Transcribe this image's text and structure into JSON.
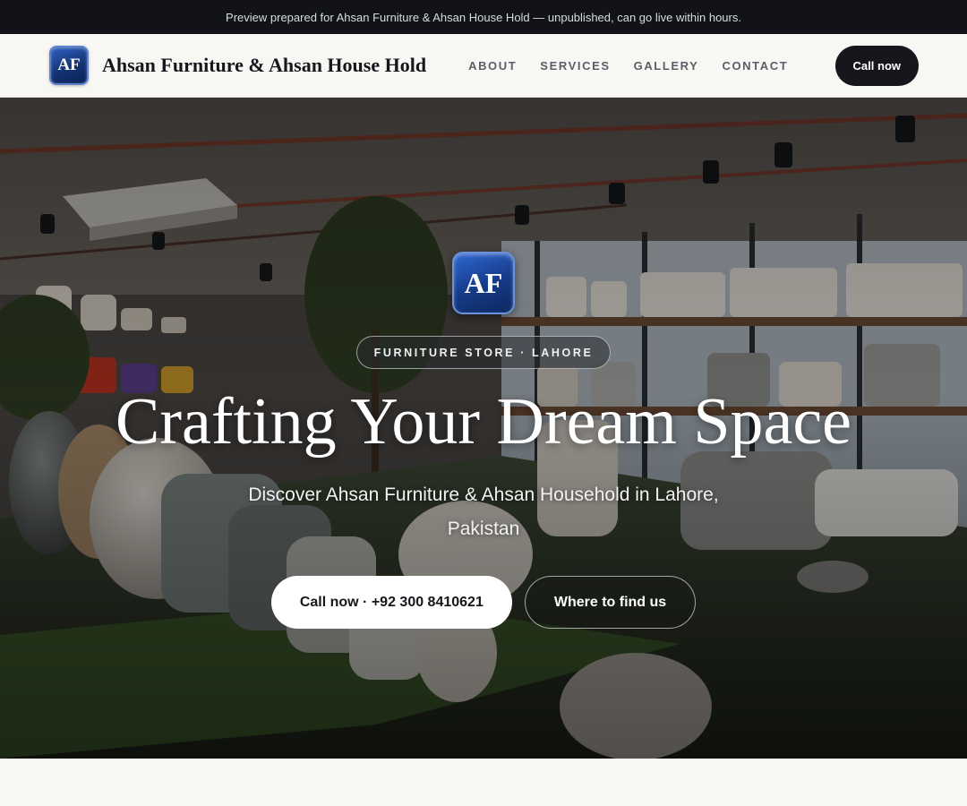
{
  "preview_banner": {
    "text": "Preview prepared for Ahsan Furniture & Ahsan House Hold — unpublished, can go live within hours."
  },
  "header": {
    "logo_text": "AF",
    "brand_name": "Ahsan Furniture & Ahsan House Hold",
    "nav": [
      {
        "label": "ABOUT"
      },
      {
        "label": "SERVICES"
      },
      {
        "label": "GALLERY"
      },
      {
        "label": "CONTACT"
      }
    ],
    "cta_label": "Call now"
  },
  "hero": {
    "logo_text": "AF",
    "eyebrow": "FURNITURE STORE · LAHORE",
    "title": "Crafting Your Dream Space",
    "subtitle": "Discover Ahsan Furniture & Ahsan Household in Lahore, Pakistan",
    "primary_cta": "Call now · +92 300 8410621",
    "secondary_cta": "Where to find us",
    "background_image_semantic": "furniture-showroom-photo"
  },
  "colors": {
    "dark": "#15171c",
    "banner_bg": "#111318",
    "page_bg": "#f8f7f4",
    "logo_blue": "#153a86"
  }
}
